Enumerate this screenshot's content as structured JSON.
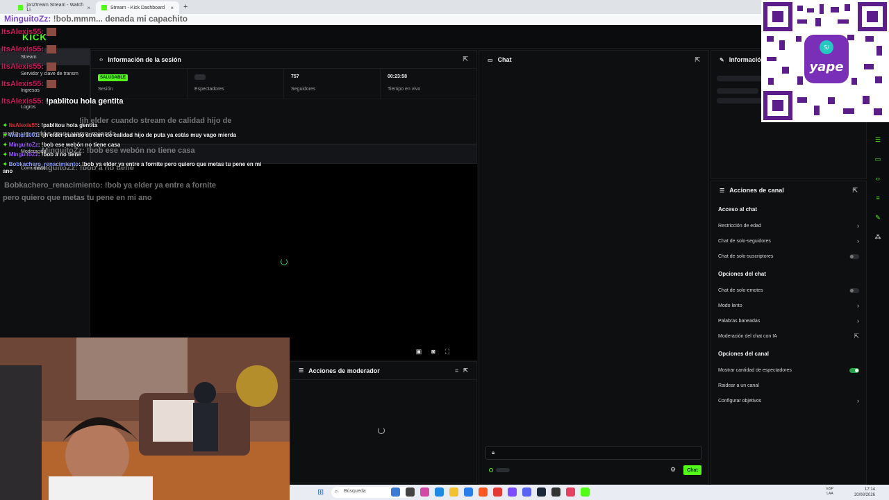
{
  "browser": {
    "tabs": [
      {
        "label": "jonZtream Stream - Watch Li",
        "active": false
      },
      {
        "label": "Stream - Kick Dashboard",
        "active": true
      }
    ],
    "new_tab": "+"
  },
  "banner": {
    "user": "MinguitoZz:",
    "message": "!bob.mmm... denada mi capachito"
  },
  "kick": {
    "logo": "KICK"
  },
  "sidebar": {
    "items": [
      {
        "label": "Stream",
        "active": true
      },
      {
        "label": "Servidor y clave de transm",
        "active": false
      },
      {
        "label": "Ingresos",
        "active": false
      },
      {
        "label": "Logros",
        "active": false
      },
      {
        "label": "Moderación",
        "active": false
      },
      {
        "label": "Comunidad",
        "active": false
      }
    ]
  },
  "session": {
    "title": "Información de la sesión",
    "cells": [
      {
        "value": "SALUDABLE",
        "label": "Sesión"
      },
      {
        "value": "",
        "label": "Espectadores"
      },
      {
        "value": "757",
        "label": "Seguidores"
      },
      {
        "value": "00:23:58",
        "label": "Tiempo en vivo"
      }
    ]
  },
  "moderator": {
    "title": "Acciones de moderador"
  },
  "chat": {
    "title": "Chat",
    "send_label": "Chat"
  },
  "info_panel": {
    "title": "Informació"
  },
  "channel_actions": {
    "title": "Acciones de canal",
    "sections": [
      {
        "title": "Acceso al chat",
        "rows": [
          {
            "label": "Restricción de edad",
            "control": "chevron"
          },
          {
            "label": "Chat de solo-seguidores",
            "control": "chevron"
          },
          {
            "label": "Chat de solo-suscriptores",
            "control": "toggle-off"
          }
        ]
      },
      {
        "title": "Opciones del chat",
        "rows": [
          {
            "label": "Chat de solo-emotes",
            "control": "toggle-off"
          },
          {
            "label": "Modo lento",
            "control": "chevron"
          },
          {
            "label": "Palabras baneadas",
            "control": "chevron"
          },
          {
            "label": "Moderación del chat con IA",
            "control": "external"
          }
        ]
      },
      {
        "title": "Opciones del canal",
        "rows": [
          {
            "label": "Mostrar cantidad de espectadores",
            "control": "toggle-on"
          },
          {
            "label": "Raidear a un canal",
            "control": "none"
          },
          {
            "label": "Configurar objetivos",
            "control": "chevron"
          }
        ]
      }
    ]
  },
  "overlay_chat": [
    {
      "user": "ItsAlexis55:",
      "message": ""
    },
    {
      "user": "ItsAlexis55:",
      "message": ""
    },
    {
      "user": "ItsAlexis55:",
      "message": ""
    },
    {
      "user": "ItsAlexis55:",
      "message": ""
    },
    {
      "user": "ItsAlexis55:",
      "message": "!pablitou hola gentita"
    }
  ],
  "ghost_lines": [
    "!jh elder cuando stream de calidad hijo de",
    "puta ya estás muy vago mierda",
    "MinguitoZz: !bob ese webón no tiene casa",
    "MinguitoZz: !bob a no tiene",
    "Bobkachero_renacimiento: !bob ya elder ya entre a fornite",
    "pero quiero que metas tu pene en mi ano"
  ],
  "small_chat": [
    {
      "user": "ItsAlexis55",
      "color": "red",
      "message": ": !pablitou hola gentita"
    },
    {
      "user": "Walter1001",
      "color": "blue",
      "message": ": !jh elder cuando stream de calidad hijo de puta ya estás muy vago mierda"
    },
    {
      "user": "MinguitoZz",
      "color": "purple",
      "message": ": !bob ese webón no tiene casa"
    },
    {
      "user": "MinguitoZz",
      "color": "purple",
      "message": ": !bob a no tiene"
    },
    {
      "user": "Bobkachero_renacimiento",
      "color": "blue",
      "message": ": !bob ya elder ya entre a fornite pero quiero que metas tu pene en mi ano"
    }
  ],
  "qr": {
    "brand": "yape"
  },
  "taskbar": {
    "search_placeholder": "Búsqueda",
    "lang_top": "ESP",
    "lang_bottom": "LAA",
    "time": "17:14",
    "date": "20/08/2026"
  }
}
